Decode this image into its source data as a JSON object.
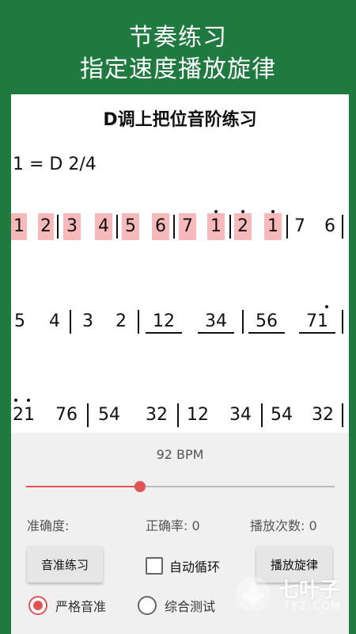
{
  "header": {
    "line1": "节奏练习",
    "line2": "指定速度播放旋律"
  },
  "sheet": {
    "title": "D调上把位音阶练习",
    "key_signature": "1 = D  2/4",
    "row1_notes": [
      "1",
      "2",
      "3",
      "4",
      "5",
      "6",
      "7",
      "1",
      "2",
      "1",
      "7",
      "6"
    ],
    "row2_notes": [
      "5",
      "4",
      "3",
      "2",
      "12",
      "34",
      "56",
      "71"
    ],
    "row3_notes": [
      "21",
      "76",
      "54",
      "32",
      "12",
      "34",
      "54",
      "32"
    ]
  },
  "controls": {
    "bpm_text": "92 BPM",
    "bpm_value": 92,
    "slider_fraction": 0.37,
    "accuracy_label": "准确度:",
    "correct_rate_label": "正确率: 0",
    "play_count_label": "播放次数: 0",
    "pitch_practice_button": "音准练习",
    "auto_loop_label": "自动循环",
    "auto_loop_checked": false,
    "play_melody_button": "播放旋律",
    "radio_strict": "严格音准",
    "radio_strict_selected": true,
    "radio_comprehensive": "综合测试",
    "radio_comprehensive_selected": false
  },
  "watermark": {
    "brand": "七叶子",
    "domain": "7YZ.COM"
  },
  "colors": {
    "header_bg": "#1e7a3e",
    "accent": "#e15454",
    "highlight": "#f7b9b9",
    "panel_bg": "#f0f0f0"
  }
}
